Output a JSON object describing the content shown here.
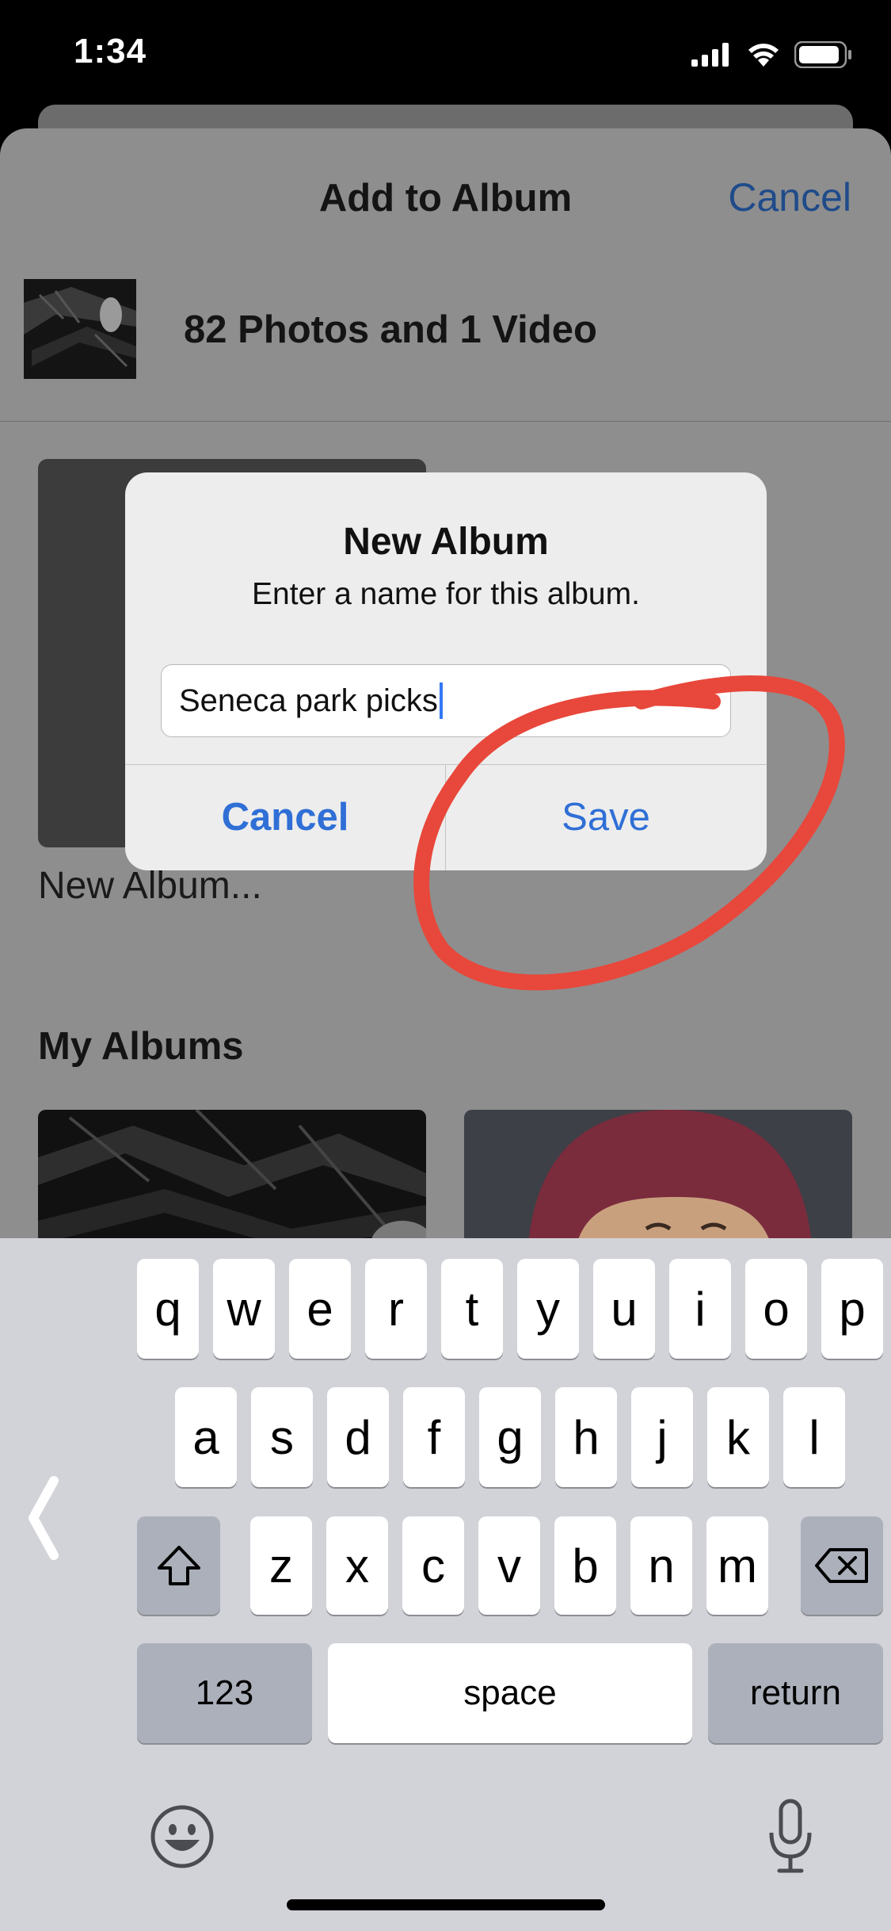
{
  "status": {
    "time": "1:34"
  },
  "sheet": {
    "title": "Add to Album",
    "cancel": "Cancel",
    "selection_count": "82 Photos and 1 Video",
    "new_album_label": "New Album...",
    "section_title": "My Albums"
  },
  "alert": {
    "title": "New Album",
    "message": "Enter a name for this album.",
    "input_value": "Seneca park picks",
    "cancel": "Cancel",
    "save": "Save"
  },
  "keyboard": {
    "row1": [
      "q",
      "w",
      "e",
      "r",
      "t",
      "y",
      "u",
      "i",
      "o",
      "p"
    ],
    "row2": [
      "a",
      "s",
      "d",
      "f",
      "g",
      "h",
      "j",
      "k",
      "l"
    ],
    "row3": [
      "z",
      "x",
      "c",
      "v",
      "b",
      "n",
      "m"
    ],
    "numbers": "123",
    "space": "space",
    "return": "return"
  },
  "colors": {
    "accent": "#2f6fd6",
    "annotation": "#e8473b"
  }
}
